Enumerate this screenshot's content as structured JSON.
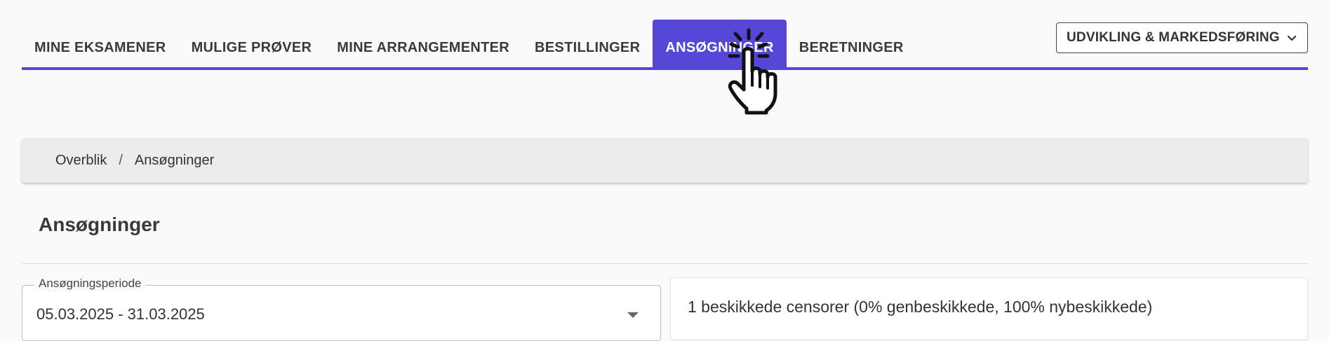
{
  "nav": {
    "tabs": [
      {
        "label": "MINE EKSAMENER",
        "active": false
      },
      {
        "label": "MULIGE PRØVER",
        "active": false
      },
      {
        "label": "MINE ARRANGEMENTER",
        "active": false
      },
      {
        "label": "BESTILLINGER",
        "active": false
      },
      {
        "label": "ANSØGNINGER",
        "active": true
      },
      {
        "label": "BERETNINGER",
        "active": false
      }
    ],
    "accent_color": "#5548d9"
  },
  "department_select": {
    "value": "UDVIKLING & MARKEDSFØRING",
    "icon": "chevron-down-icon"
  },
  "cursor": {
    "icon": "hand-pointer-click-icon"
  },
  "breadcrumb": {
    "items": [
      "Overblik",
      "Ansøgninger"
    ],
    "separator": "/"
  },
  "page": {
    "title": "Ansøgninger"
  },
  "period": {
    "label": "Ansøgningsperiode",
    "value": "05.03.2025 - 31.03.2025"
  },
  "summary": {
    "text": "1 beskikkede censorer (0% genbeskikkede, 100% nybeskikkede)"
  }
}
